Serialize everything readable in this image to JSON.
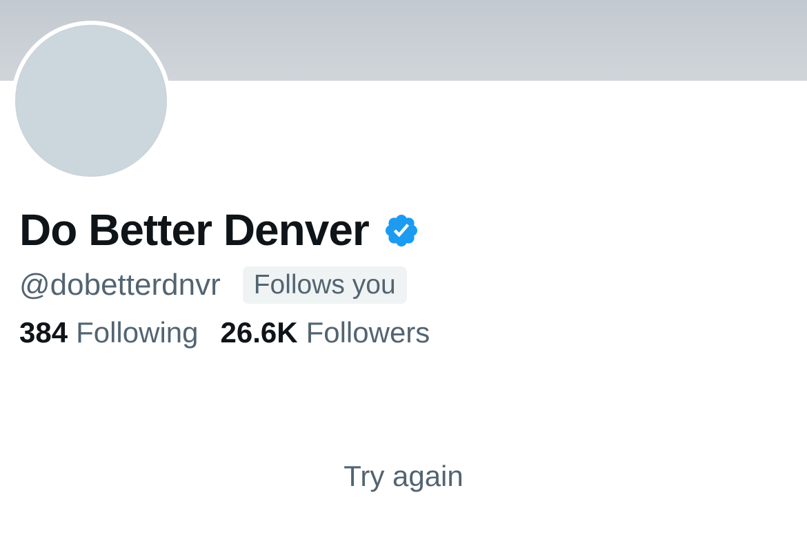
{
  "profile": {
    "display_name": "Do Better Denver",
    "handle": "@dobetterdnvr",
    "follows_you_label": "Follows you",
    "verified_icon": "verified-badge-icon",
    "following": {
      "count": "384",
      "label": "Following"
    },
    "followers": {
      "count": "26.6K",
      "label": "Followers"
    }
  },
  "error": {
    "retry_label": "Try again"
  },
  "colors": {
    "banner": "#c3c9d0",
    "avatar_placeholder": "#ccd6dd",
    "verified_blue": "#1d9bf0",
    "primary_text": "#0f1419",
    "secondary_text": "#536471",
    "badge_background": "#eff3f4"
  }
}
